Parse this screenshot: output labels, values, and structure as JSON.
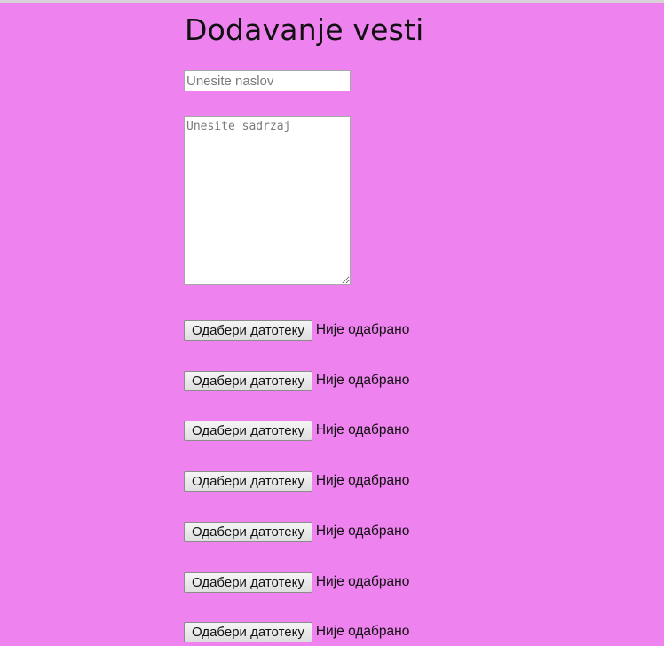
{
  "page": {
    "heading": "Dodavanje vesti",
    "background_color": "#ee82ee"
  },
  "form": {
    "title_placeholder": "Unesite naslov",
    "title_value": "",
    "content_placeholder": "Unesite sadrzaj",
    "content_value": "",
    "file_inputs": [
      {
        "button_label": "Одабери датотеку",
        "status": "Није одабрано"
      },
      {
        "button_label": "Одабери датотеку",
        "status": "Није одабрано"
      },
      {
        "button_label": "Одабери датотеку",
        "status": "Није одабрано"
      },
      {
        "button_label": "Одабери датотеку",
        "status": "Није одабрано"
      },
      {
        "button_label": "Одабери датотеку",
        "status": "Није одабрано"
      },
      {
        "button_label": "Одабери датотеку",
        "status": "Није одабрано"
      },
      {
        "button_label": "Одабери датотеку",
        "status": "Није одабрано"
      }
    ]
  }
}
